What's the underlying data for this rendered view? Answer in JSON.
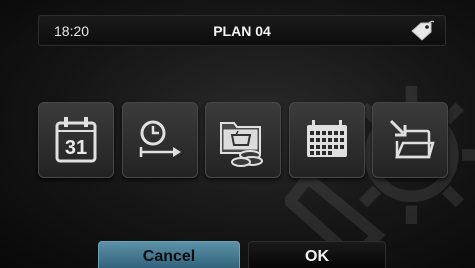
{
  "status_bar": {
    "time": "18:20",
    "title": "PLAN 04",
    "tag_icon": "tag-icon"
  },
  "icons": [
    {
      "name": "calendar-day-icon",
      "day": "31"
    },
    {
      "name": "time-shift-icon"
    },
    {
      "name": "recipe-folder-coins-icon"
    },
    {
      "name": "calendar-grid-icon"
    },
    {
      "name": "save-to-folder-icon"
    }
  ],
  "buttons": {
    "cancel": "Cancel",
    "ok": "OK"
  },
  "colors": {
    "accent": "#3f7a94",
    "background": "#151515",
    "icon_face": "#2f2f2f"
  }
}
